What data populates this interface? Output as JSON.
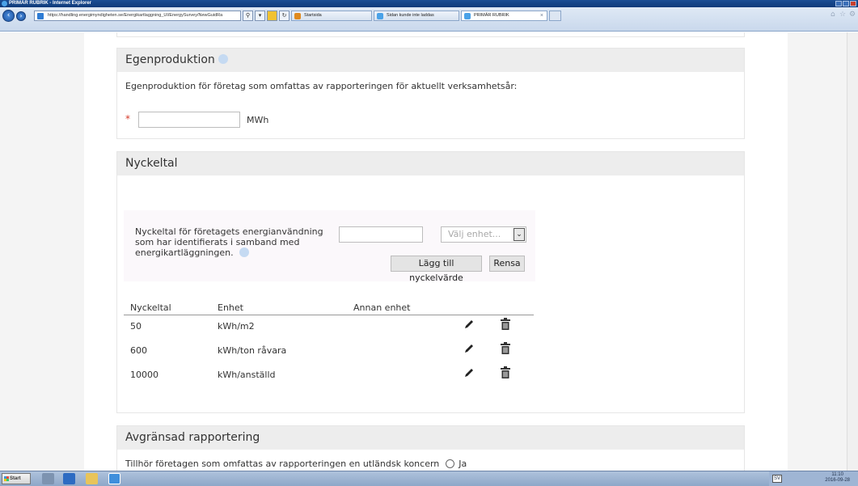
{
  "window": {
    "title": "PRIMÄR RUBRIK - Internet Explorer"
  },
  "browser": {
    "url": "https://handling.energimyndigheten.se/Energikartlaggning_UI/EnergySurvey/NewGuidRa",
    "tabs": [
      {
        "label": "Startsida",
        "color": "#e08a1e"
      },
      {
        "label": "Sidan kunde inte laddas",
        "color": "#4aa2e8"
      },
      {
        "label": "PRIMÄR RUBRIK",
        "color": "#4aa2e8"
      }
    ]
  },
  "egenproduktion": {
    "title": "Egenproduktion",
    "description": "Egenproduktion för företag som omfattas av rapporteringen för aktuellt verksamhetsår:",
    "required_marker": "*",
    "value": "",
    "unit": "MWh"
  },
  "nyckeltal": {
    "title": "Nyckeltal",
    "form_text": "Nyckeltal för företagets energianvändning som har identifierats i samband med energikartläggningen.",
    "value": "",
    "unit_placeholder": "Välj enhet...",
    "add_button": "Lägg till nyckelvärde",
    "clear_button": "Rensa",
    "table": {
      "headers": [
        "Nyckeltal",
        "Enhet",
        "Annan enhet"
      ],
      "rows": [
        {
          "value": "50",
          "unit": "kWh/m2",
          "other": ""
        },
        {
          "value": "600",
          "unit": "kWh/ton råvara",
          "other": ""
        },
        {
          "value": "10000",
          "unit": "kWh/anställd",
          "other": ""
        }
      ]
    }
  },
  "avgransad": {
    "title": "Avgränsad rapportering",
    "question": "Tillhör företagen som omfattas av rapporteringen en utländsk koncern",
    "option_yes": "Ja"
  },
  "taskbar": {
    "start": "Start",
    "lang": "SV",
    "time": "11:10",
    "date": "2016-09-28"
  }
}
